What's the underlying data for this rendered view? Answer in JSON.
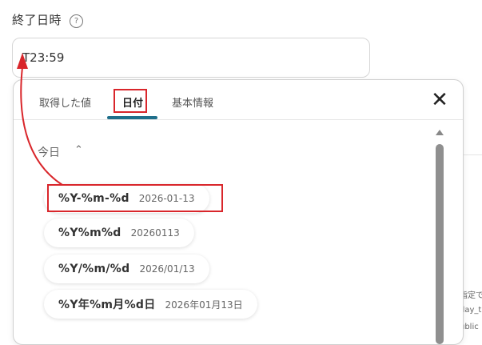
{
  "field": {
    "label": "終了日時",
    "help_icon": "?",
    "value": "T23:59"
  },
  "popup": {
    "tabs": [
      {
        "label": "取得した値",
        "active": false
      },
      {
        "label": "日付",
        "active": true
      },
      {
        "label": "基本情報",
        "active": false
      }
    ],
    "close_icon": "✕",
    "section": {
      "title": "今日",
      "chevron": "⌃"
    },
    "formats": [
      {
        "format": "%Y-%m-%d",
        "example": "2026-01-13"
      },
      {
        "format": "%Y%m%d",
        "example": "20260113"
      },
      {
        "format": "%Y/%m/%d",
        "example": "2026/01/13"
      },
      {
        "format": "%Y年%m月%d日",
        "example": "2026年01月13日"
      }
    ]
  },
  "background_clip": {
    "line1": "指定で",
    "line2": "day_t",
    "line3": "ublic"
  },
  "colors": {
    "accent": "#1f6f8b",
    "annotation_red": "#d9262b"
  }
}
